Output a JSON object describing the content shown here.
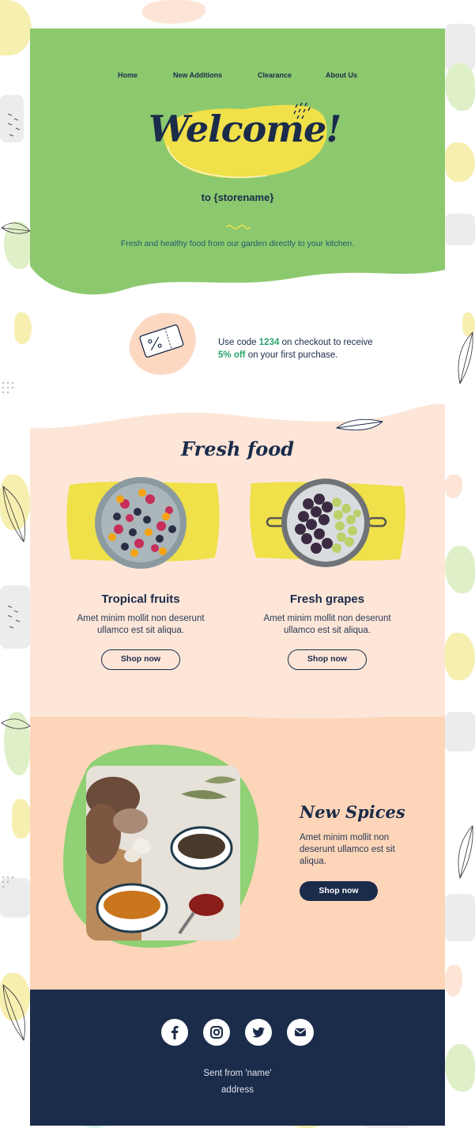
{
  "nav": {
    "items": [
      "Home",
      "New Additions",
      "Clearance",
      "About Us"
    ]
  },
  "hero": {
    "title": "Welcome!",
    "subtitle": "to {storename}",
    "tagline": "Fresh and healthy food from our garden directly to your kitchen."
  },
  "promo": {
    "line1_before": "Use code ",
    "code": "1234",
    "line1_after": " on checkout to receive",
    "discount": "5% off",
    "line2_after": " on your first purchase."
  },
  "fresh": {
    "title": "Fresh food",
    "products": [
      {
        "name": "Tropical fruits",
        "desc": "Amet minim mollit non deserunt ullamco est sit aliqua.",
        "cta": "Shop now"
      },
      {
        "name": "Fresh grapes",
        "desc": "Amet minim mollit non deserunt ullamco est sit aliqua.",
        "cta": "Shop now"
      }
    ]
  },
  "spices": {
    "title": "New Spices",
    "desc": "Amet minim mollit non deserunt ullamco est sit aliqua.",
    "cta": "Shop now"
  },
  "footer": {
    "sent_from": "Sent from 'name'",
    "address": "address",
    "socials": [
      "facebook-icon",
      "instagram-icon",
      "twitter-icon",
      "email-icon"
    ]
  },
  "colors": {
    "hero_green": "#8cc96e",
    "navy": "#1b2b4a",
    "peach_light": "#fde6d8",
    "peach": "#fdd5b9",
    "yellow": "#f0e04a",
    "accent_green": "#2aa36b"
  }
}
